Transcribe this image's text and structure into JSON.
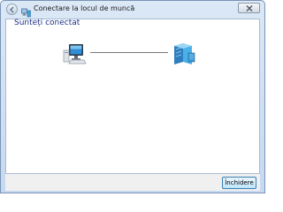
{
  "window": {
    "title": "Conectare la locul de muncă",
    "close_glyph": "✕"
  },
  "icons": {
    "back": "back-arrow-icon",
    "app": "network-app-icon",
    "computer": "computer-icon",
    "server": "server-icon"
  },
  "main": {
    "heading": "Sunteți conectat"
  },
  "footer": {
    "finish_label": "Închidere"
  },
  "colors": {
    "heading": "#1e3287",
    "frame": "#c6d9ef",
    "button_border": "#3c7fb1"
  }
}
